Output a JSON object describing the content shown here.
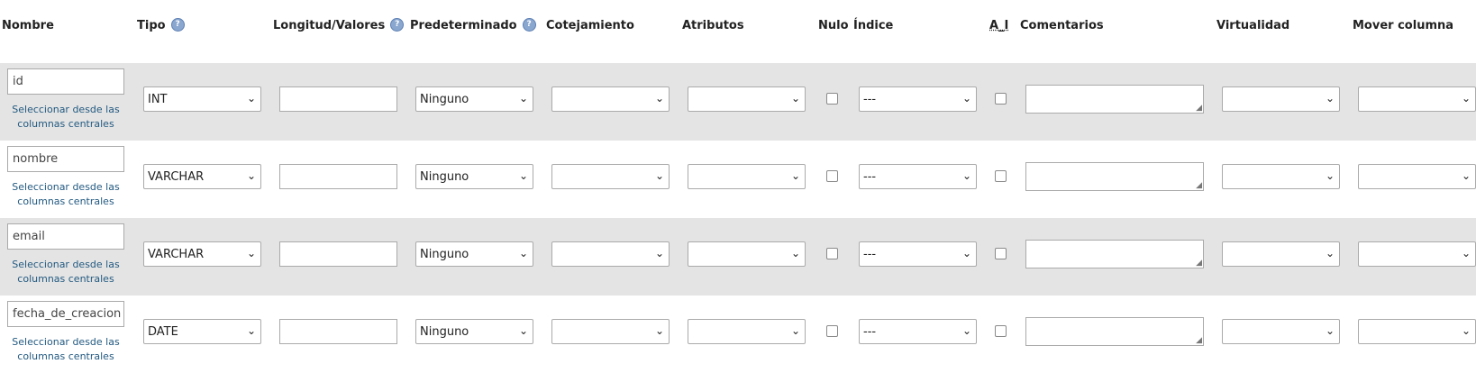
{
  "headers": {
    "nombre": "Nombre",
    "tipo": "Tipo",
    "longitud": "Longitud/Valores",
    "predeterminado": "Predeterminado",
    "cotejamiento": "Cotejamiento",
    "atributos": "Atributos",
    "nulo": "Nulo",
    "indice": "Índice",
    "ai": "A_I",
    "comentarios": "Comentarios",
    "virtualidad": "Virtualidad",
    "mover": "Mover columna"
  },
  "help_icon": "?",
  "central_link": [
    "Seleccionar desde las",
    "columnas centrales"
  ],
  "columns": [
    {
      "name": "id",
      "type": "INT",
      "length": "",
      "default": "Ninguno",
      "collation": "",
      "attributes": "",
      "null": false,
      "index": "---",
      "ai": false,
      "comments": "",
      "virtuality": "",
      "move": ""
    },
    {
      "name": "nombre",
      "type": "VARCHAR",
      "length": "",
      "default": "Ninguno",
      "collation": "",
      "attributes": "",
      "null": false,
      "index": "---",
      "ai": false,
      "comments": "",
      "virtuality": "",
      "move": ""
    },
    {
      "name": "email",
      "type": "VARCHAR",
      "length": "",
      "default": "Ninguno",
      "collation": "",
      "attributes": "",
      "null": false,
      "index": "---",
      "ai": false,
      "comments": "",
      "virtuality": "",
      "move": ""
    },
    {
      "name": "fecha_de_creacion",
      "type": "DATE",
      "length": "",
      "default": "Ninguno",
      "collation": "",
      "attributes": "",
      "null": false,
      "index": "---",
      "ai": false,
      "comments": "",
      "virtuality": "",
      "move": ""
    }
  ],
  "icons": {
    "dropdown": "chevron-down-icon",
    "help": "help-circle-icon",
    "resize": "resize-grip-icon"
  },
  "colors": {
    "row_alt": "#e4e4e4",
    "link": "#235a81",
    "help": "#8aa7cf"
  }
}
